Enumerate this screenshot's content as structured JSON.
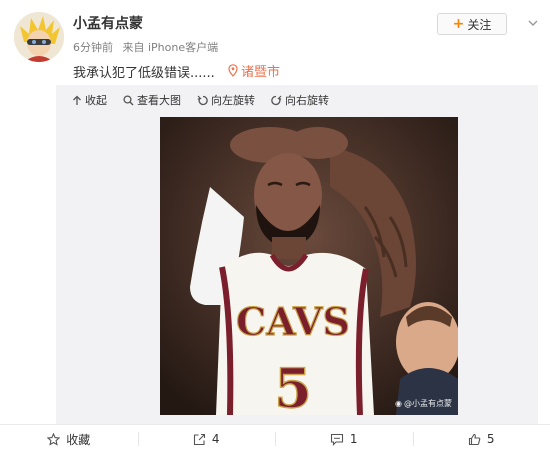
{
  "post": {
    "username": "小孟有点蒙",
    "time": "6分钟前",
    "source": "来自 iPhone客户端",
    "text": "我承认犯了低级错误......",
    "location": "诸暨市"
  },
  "header": {
    "follow_label": "关注"
  },
  "toolbar": {
    "collapse": "收起",
    "view_large": "查看大图",
    "rotate_left": "向左旋转",
    "rotate_right": "向右旋转"
  },
  "image": {
    "jersey_text": "CAVS",
    "jersey_number": "5",
    "watermark": "@小孟有点蒙"
  },
  "footer": {
    "favorite_label": "收藏",
    "repost_count": "4",
    "comment_count": "1",
    "like_count": "5"
  },
  "colors": {
    "accent_orange": "#ff8200",
    "location_color": "#eb7350",
    "jersey_wine": "#7a1f2b",
    "jersey_gold": "#c9a24a"
  }
}
